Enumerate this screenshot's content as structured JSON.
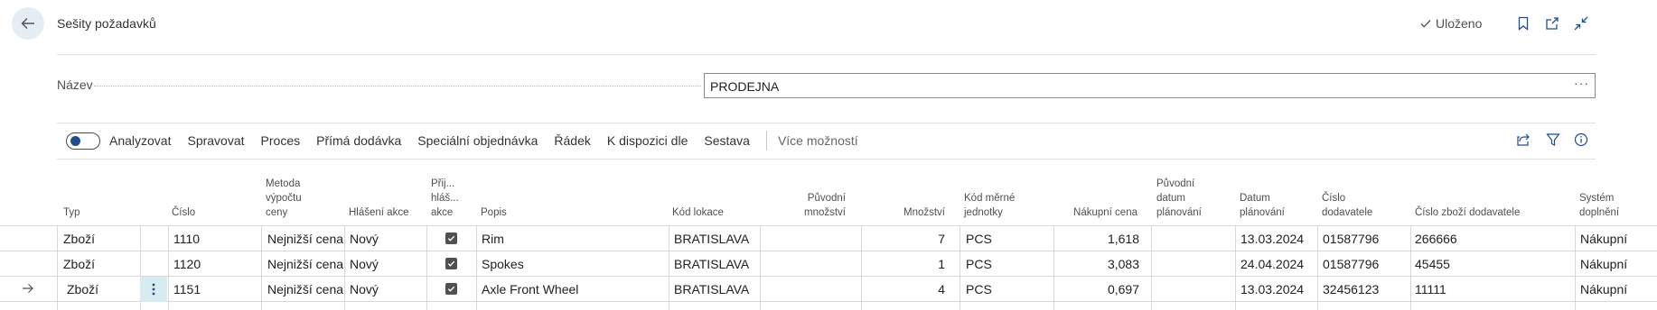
{
  "header": {
    "title": "Sešity požadavků",
    "saved_label": "Uloženo"
  },
  "icons": {
    "back": "arrow-left-icon",
    "bookmark": "bookmark-icon",
    "open_new": "open-new-window-icon",
    "collapse": "collapse-icon",
    "share": "share-icon",
    "filter": "filter-icon",
    "info": "info-icon"
  },
  "colors": {
    "accent": "#1e4e8c",
    "selected_cell": "#d6ecf1",
    "back_bg": "#e6eef5"
  },
  "name_field": {
    "label": "Název",
    "value": "PRODEJNA",
    "more": "···"
  },
  "toolbar": {
    "analyze_label": "Analyzovat",
    "analyze_on": true,
    "items": [
      "Spravovat",
      "Proces",
      "Přímá dodávka",
      "Speciální objednávka",
      "Řádek",
      "K dispozici dle",
      "Sestava"
    ],
    "more_label": "Více možností"
  },
  "table": {
    "columns": {
      "typ": "Typ",
      "cislo": "Číslo",
      "metoda": [
        "Metoda",
        "výpočtu",
        "ceny"
      ],
      "hlaseni": "Hlášení akce",
      "prij": [
        "Přij...",
        "hláš...",
        "akce"
      ],
      "popis": "Popis",
      "kod_lokace": "Kód lokace",
      "puvodni_mnozstvi": [
        "Původní",
        "množství"
      ],
      "mnozstvi": "Množství",
      "kod_merne": [
        "Kód měrné",
        "jednotky"
      ],
      "nakupni_cena": "Nákupní cena",
      "puvodni_datum": [
        "Původní",
        "datum",
        "plánování"
      ],
      "datum_planovani": [
        "Datum",
        "plánování"
      ],
      "cislo_dodavatele": [
        "Číslo",
        "dodavatele"
      ],
      "cislo_zbozi_dodavatele": "Číslo zboží dodavatele",
      "system": [
        "Systém",
        "doplnění"
      ]
    },
    "rows": [
      {
        "typ": "Zboží",
        "cislo": "1110",
        "metoda": "Nejnižší cena",
        "hlaseni": "Nový",
        "prijmout": true,
        "popis": "Rim",
        "lokace": "BRATISLAVA",
        "puvodni_mnozstvi": "",
        "mnozstvi": "7",
        "jednotka": "PCS",
        "cena": "1,618",
        "puvodni_datum": "",
        "datum": "13.03.2024",
        "dodavatel": "01587796",
        "zbozi_dodavatele": "266666",
        "system": "Nákupní"
      },
      {
        "typ": "Zboží",
        "cislo": "1120",
        "metoda": "Nejnižší cena",
        "hlaseni": "Nový",
        "prijmout": true,
        "popis": "Spokes",
        "lokace": "BRATISLAVA",
        "puvodni_mnozstvi": "",
        "mnozstvi": "1",
        "jednotka": "PCS",
        "cena": "3,083",
        "puvodni_datum": "",
        "datum": "24.04.2024",
        "dodavatel": "01587796",
        "zbozi_dodavatele": "45455",
        "system": "Nákupní"
      },
      {
        "typ": "Zboží",
        "cislo": "1151",
        "metoda": "Nejnižší cena",
        "hlaseni": "Nový",
        "prijmout": true,
        "popis": "Axle Front Wheel",
        "lokace": "BRATISLAVA",
        "puvodni_mnozstvi": "",
        "mnozstvi": "4",
        "jednotka": "PCS",
        "cena": "0,697",
        "puvodni_datum": "",
        "datum": "13.03.2024",
        "dodavatel": "32456123",
        "zbozi_dodavatele": "11111",
        "system": "Nákupní",
        "current": true
      }
    ]
  }
}
